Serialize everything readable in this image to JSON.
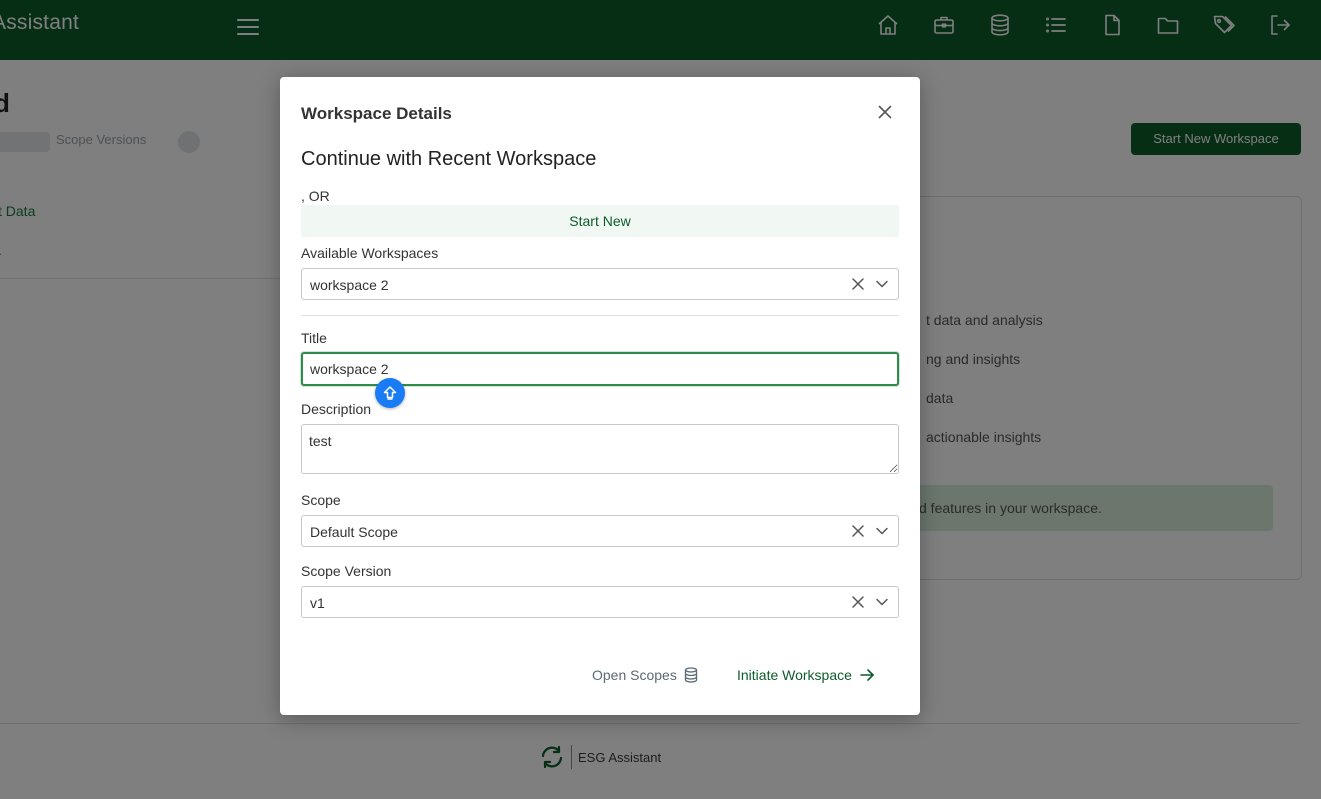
{
  "app": {
    "brand": "Assistant",
    "nav_icons": [
      "home-icon",
      "briefcase-icon",
      "database-icon",
      "list-icon",
      "file-icon",
      "folder-icon",
      "tags-icon",
      "logout-icon"
    ]
  },
  "background": {
    "heading": "d",
    "breadcrumb": "Scope Versions",
    "link": "t Data",
    "cta": "Start New Workspace",
    "card_lines": [
      "t data and analysis",
      "ng and insights",
      "data",
      "actionable insights"
    ],
    "callout": "d features in your workspace."
  },
  "modal": {
    "title": "Workspace Details",
    "recent_heading": "Continue with Recent Workspace",
    "or_text": ", OR",
    "start_new": "Start New",
    "available_label": "Available Workspaces",
    "available_value": "workspace 2",
    "title_label": "Title",
    "title_value": "workspace 2",
    "description_label": "Description",
    "description_value": "test",
    "scope_label": "Scope",
    "scope_value": "Default Scope",
    "scope_version_label": "Scope Version",
    "scope_version_value": "v1",
    "open_scopes": "Open Scopes",
    "initiate": "Initiate Workspace"
  },
  "footer": {
    "brand": "ESG Assistant"
  },
  "colors": {
    "primary": "#0d5c2a",
    "accent_blue": "#1a7cf5",
    "backdrop": "rgba(0,0,0,0.5)"
  }
}
